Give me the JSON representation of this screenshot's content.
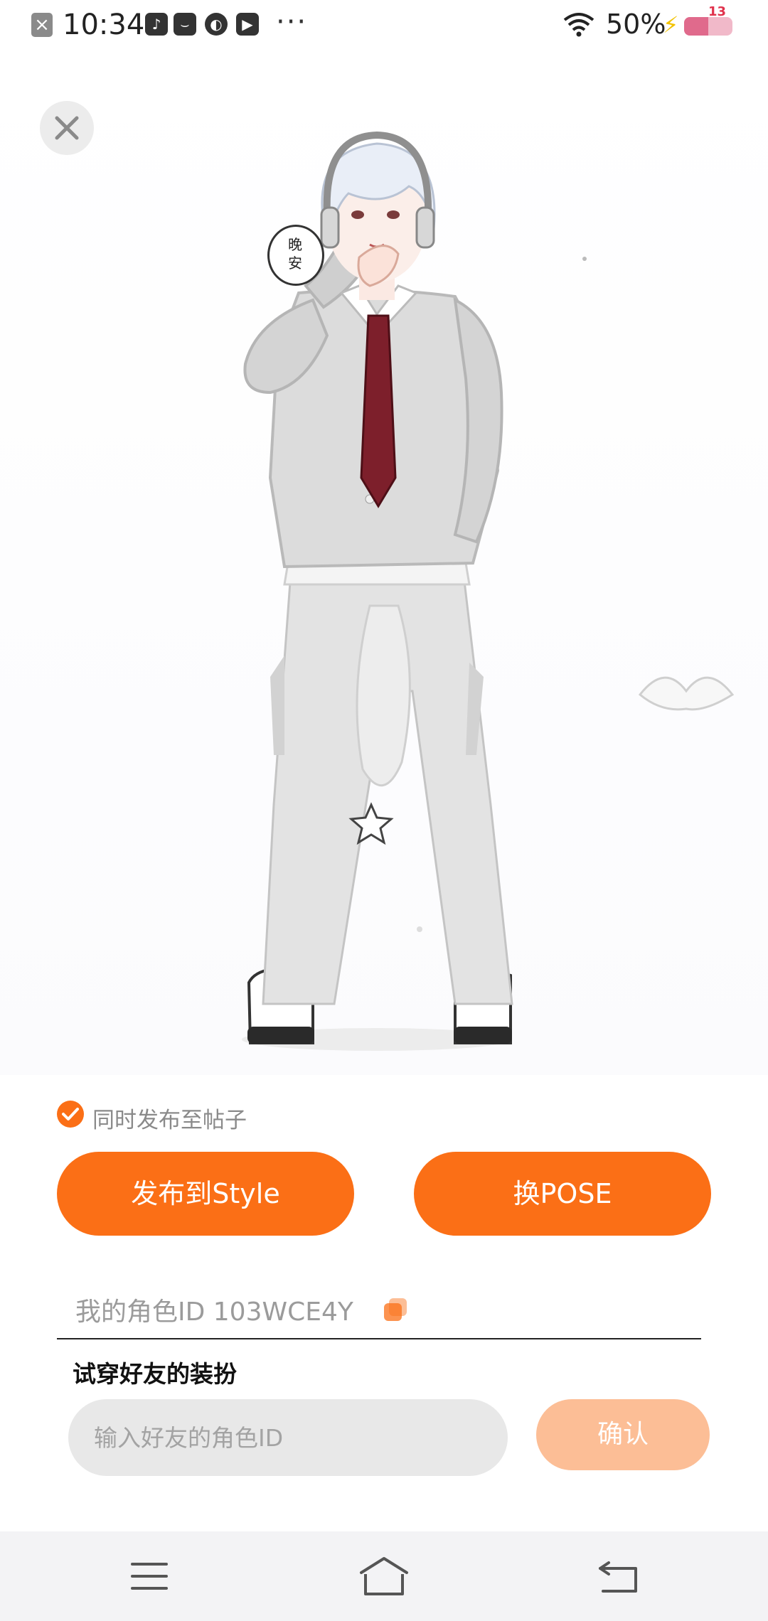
{
  "status_bar": {
    "time": "10:34",
    "overflow": "···",
    "battery_percent": "50%",
    "battery_level": 0.5,
    "notification_count": "13",
    "icons": [
      "app-closed-icon",
      "tiktok-icon",
      "pocket-icon",
      "planet-icon",
      "play-icon",
      "wifi-icon",
      "charging-icon",
      "battery-icon"
    ]
  },
  "character": {
    "speech_bubble": "晚安"
  },
  "publish": {
    "sync_label": "同时发布至帖子",
    "sync_checked": true,
    "publish_button": "发布到Style",
    "pose_button": "换POSE"
  },
  "my_id": {
    "label": "我的角色ID 103WCE4Y"
  },
  "try_on": {
    "title": "试穿好友的装扮",
    "input_placeholder": "输入好友的角色ID",
    "input_value": "",
    "confirm_button": "确认"
  },
  "colors": {
    "accent": "#fb6f16",
    "accent_disabled": "#fcbe96",
    "input_bg": "#e8e8e8"
  },
  "nav_bar": {
    "icons": [
      "menu-icon",
      "home-icon",
      "back-icon"
    ]
  }
}
